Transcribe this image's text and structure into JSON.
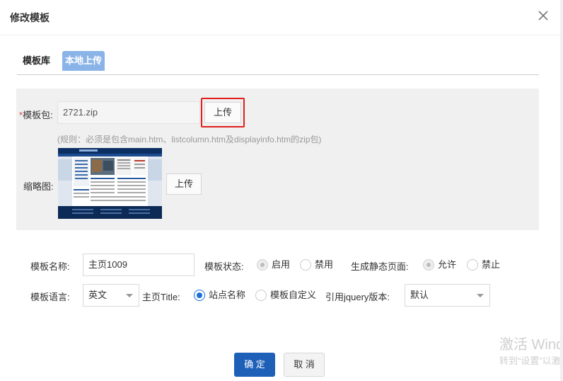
{
  "dialog": {
    "title": "修改模板",
    "close_icon": "close-icon"
  },
  "tabs": [
    {
      "label": "模板库",
      "active": false
    },
    {
      "label": "本地上传",
      "active": true
    }
  ],
  "upload": {
    "package_required_mark": "*",
    "package_label": "模板包:",
    "package_value": "2721.zip",
    "package_button": "上传",
    "rule_text": "(规则：必须是包含main.htm、listcolumn.htm及displayinfo.htm的zip包)",
    "thumbnail_label": "缩略图:",
    "thumbnail_button": "上传"
  },
  "form": {
    "name_label": "模板名称:",
    "name_value": "主页1009",
    "status_label": "模板状态:",
    "status_options": [
      {
        "label": "启用",
        "selected": true,
        "disabled": true
      },
      {
        "label": "禁用",
        "selected": false,
        "disabled": true
      }
    ],
    "static_label": "生成静态页面:",
    "static_options": [
      {
        "label": "允许",
        "selected": true,
        "disabled": true
      },
      {
        "label": "禁止",
        "selected": false,
        "disabled": true
      }
    ],
    "lang_label": "模板语言:",
    "lang_value": "英文",
    "title_label": "主页Title:",
    "title_options": [
      {
        "label": "站点名称",
        "selected": true
      },
      {
        "label": "模板自定义",
        "selected": false
      }
    ],
    "jquery_label": "引用jquery版本:",
    "jquery_value": "默认"
  },
  "footer": {
    "ok_label": "确 定",
    "cancel_label": "取 消"
  },
  "watermark": {
    "line1": "激活 Windows",
    "line2": "转到“设置”以激活 Windows。"
  },
  "colors": {
    "primary": "#1e5fb8",
    "tab_active": "#8ab4e8",
    "highlight_border": "#e0201c",
    "radio_on": "#1e6fd9"
  }
}
